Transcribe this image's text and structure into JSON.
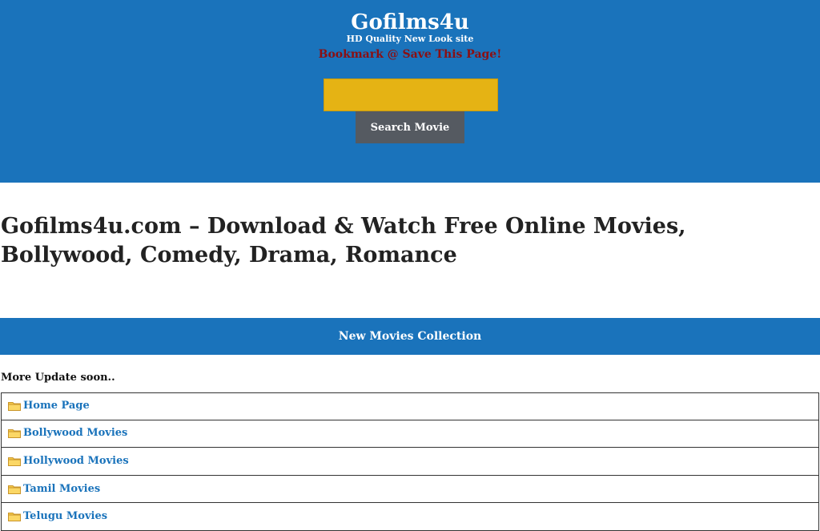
{
  "header": {
    "site_title": "Gofilms4u",
    "tagline": "HD Quality New Look site",
    "bookmark_text": "Bookmark @ Save This Page!",
    "search_value": "",
    "search_button_label": "Search Movie"
  },
  "main": {
    "heading_line1": "Gofilms4u.com – Download & Watch Free Online Movies,",
    "heading_line2": "Bollywood, Comedy, Drama, Romance",
    "section_title": "New Movies Collection",
    "update_note": "More Update soon.."
  },
  "menu": {
    "items": [
      {
        "label": "Home Page",
        "icon": "folder-icon"
      },
      {
        "label": "Bollywood Movies",
        "icon": "folder-icon"
      },
      {
        "label": "Hollywood Movies",
        "icon": "folder-icon"
      },
      {
        "label": "Tamil Movies",
        "icon": "folder-icon"
      },
      {
        "label": "Telugu Movies",
        "icon": "folder-icon"
      }
    ]
  },
  "colors": {
    "header_bg": "#1a73bb",
    "search_input_bg": "#e5b314",
    "search_button_bg": "#555a61",
    "bookmark_text": "#8b0f12",
    "link": "#1a73bb"
  }
}
